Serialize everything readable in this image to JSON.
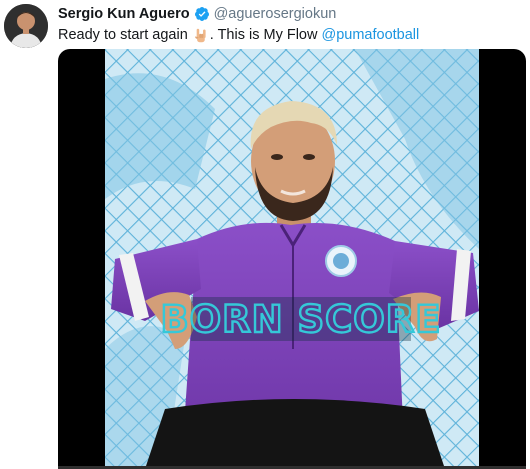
{
  "tweet": {
    "display_name": "Sergio Kun Aguero",
    "username": "@aguerosergiokun",
    "text_before_emoji": "Ready to start again",
    "emoji": "sign-of-the-horns-emoji",
    "text_after_emoji": ". This is My Flow",
    "mention": "@pumafootball"
  },
  "media": {
    "overlay_text": "BORN SCORE",
    "colors": {
      "background": "#000000",
      "net": "#bfe3f3",
      "jersey": "#7a3fb7",
      "neon_text": "#35c8d8"
    }
  },
  "icons": {
    "verified": "verified-badge-icon",
    "avatar": "avatar"
  },
  "colors": {
    "link": "#1b95e0",
    "username": "#657786",
    "name": "#14171a",
    "verified": "#1da1f2"
  }
}
